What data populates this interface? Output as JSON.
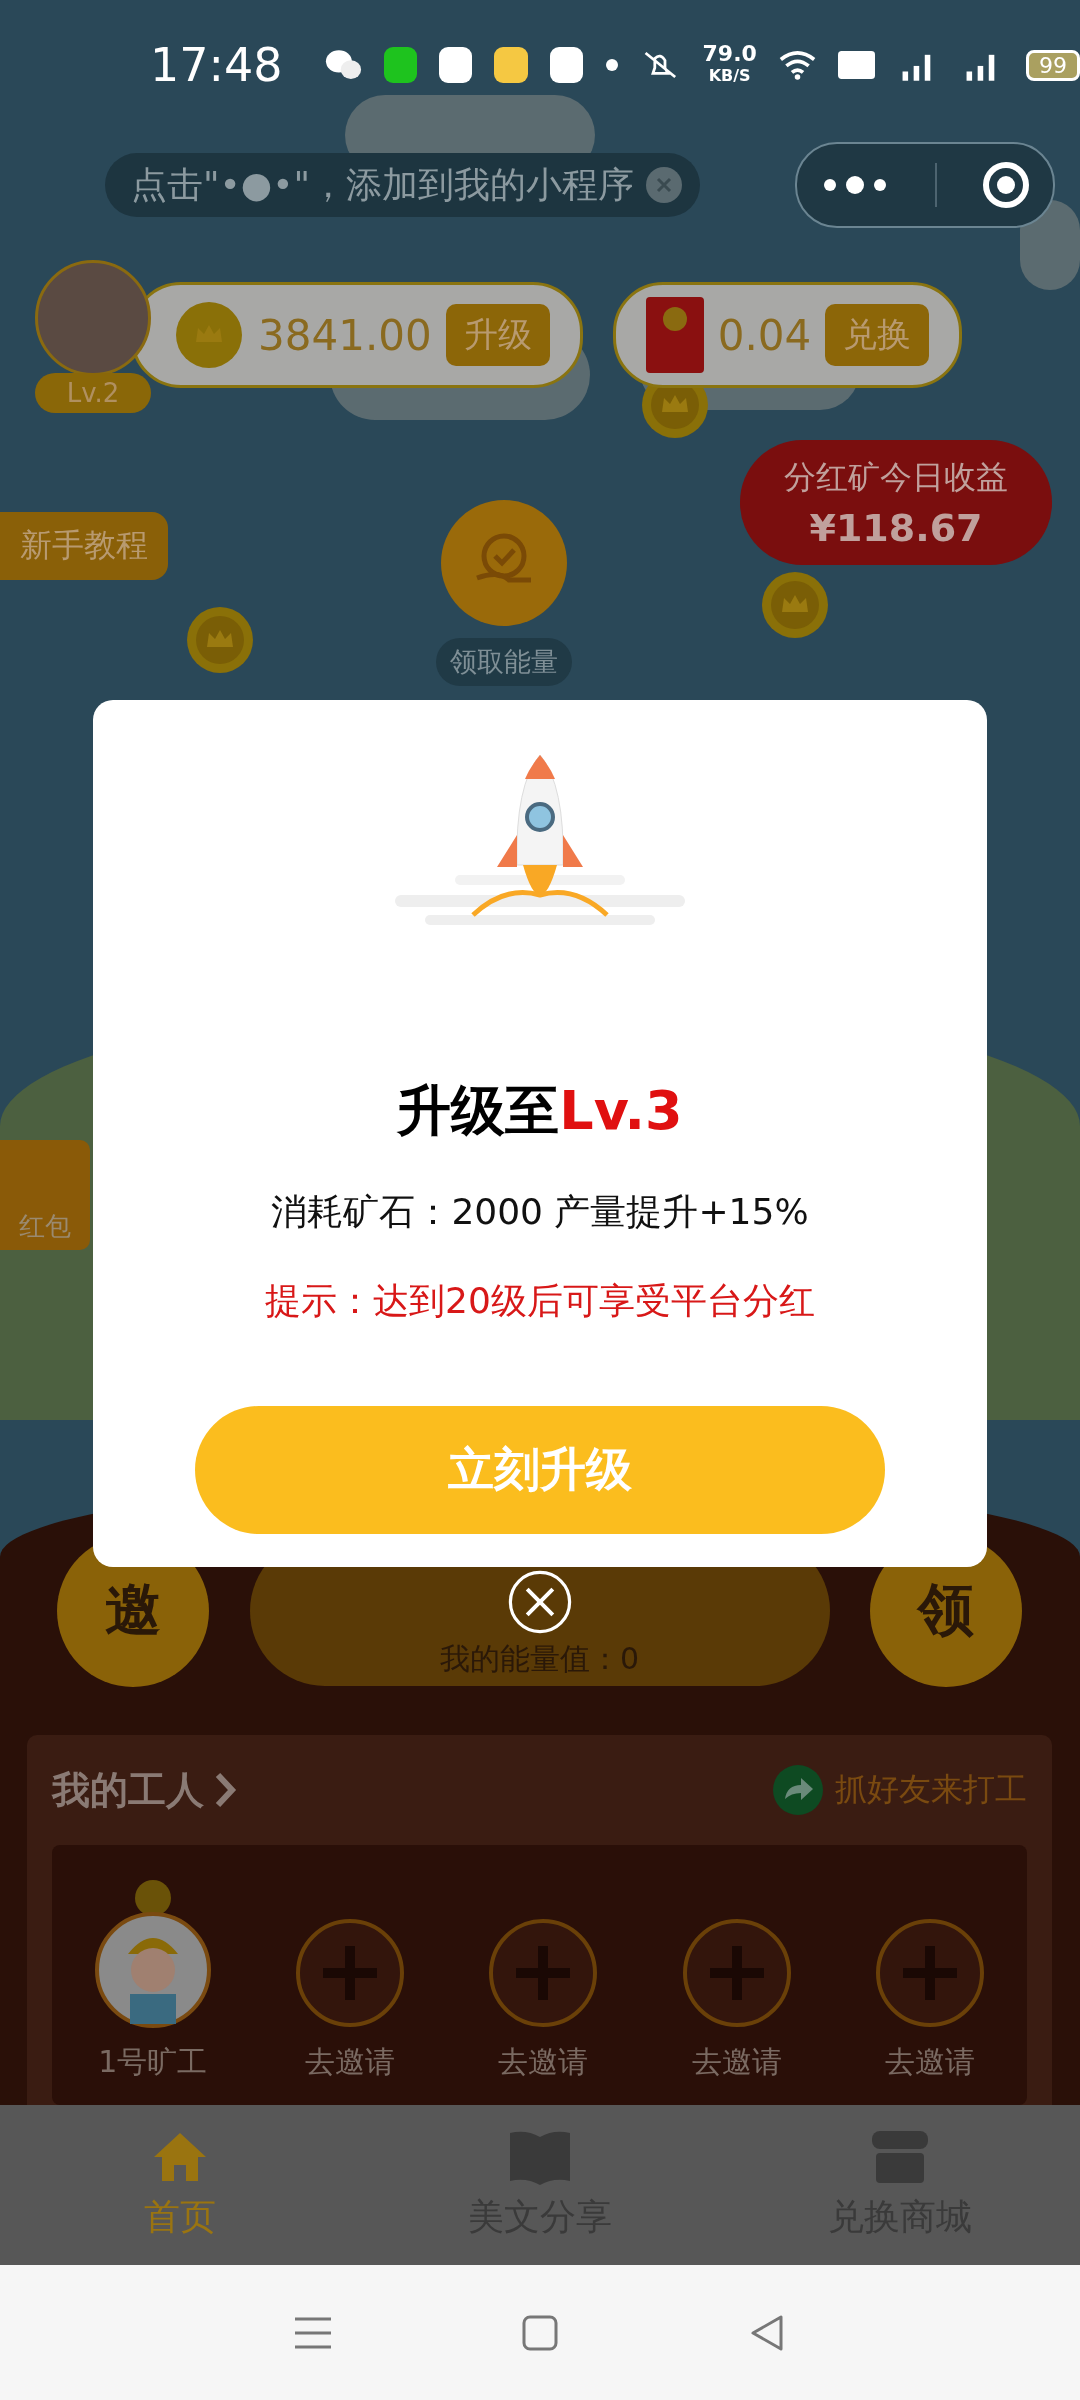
{
  "status_bar": {
    "time": "17:48",
    "speed": "79.0",
    "speed_unit": "KB/S",
    "battery": "99"
  },
  "hint_bar": {
    "text": "点击\"•●•\"，添加到我的小程序"
  },
  "user": {
    "level": "Lv.2"
  },
  "balances": [
    {
      "kind": "coin",
      "amount": "3841.00",
      "action": "升级"
    },
    {
      "kind": "red_packet",
      "amount": "0.04",
      "action": "兑换"
    }
  ],
  "tutorial": "新手教程",
  "dividend": {
    "title": "分红矿今日收益",
    "amount": "¥118.67"
  },
  "energy_button": "领取能量",
  "side_tag": "红包",
  "actions": {
    "invite": "邀",
    "claim": "领",
    "energy": "我的能量值：0"
  },
  "workers": {
    "title": "我的工人",
    "invite_link": "抓好友来打工",
    "slots": [
      {
        "kind": "worker",
        "label": "1号旷工"
      },
      {
        "kind": "empty",
        "label": "去邀请"
      },
      {
        "kind": "empty",
        "label": "去邀请"
      },
      {
        "kind": "empty",
        "label": "去邀请"
      },
      {
        "kind": "empty",
        "label": "去邀请"
      }
    ]
  },
  "tabs": [
    {
      "label": "首页",
      "selected": true
    },
    {
      "label": "美文分享",
      "selected": false
    },
    {
      "label": "兑换商城",
      "selected": false
    }
  ],
  "modal": {
    "title": "升级至",
    "title_level": "Lv.3",
    "cost": "消耗矿石：2000 产量提升+15%",
    "hint": "提示：达到20级后可享受平台分红",
    "button": "立刻升级"
  }
}
